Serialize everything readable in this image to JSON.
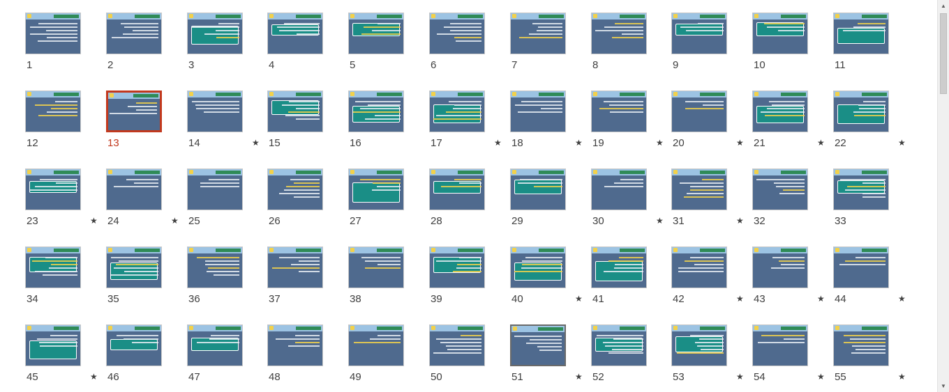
{
  "view": "slide-sorter",
  "selected_slide": "13",
  "current_slide": "51",
  "colors": {
    "slide_bg": "#4f6a8e",
    "title_band": "#9cc3e3",
    "title_bar": "#2f8b57",
    "accent_box": "#1a8e86",
    "selection": "#c2391e"
  },
  "scrollbar": {
    "up_icon": "▲",
    "down_icon": "▼"
  },
  "slides": [
    {
      "number": "1",
      "star": ""
    },
    {
      "number": "2",
      "star": ""
    },
    {
      "number": "3",
      "star": ""
    },
    {
      "number": "4",
      "star": ""
    },
    {
      "number": "5",
      "star": ""
    },
    {
      "number": "6",
      "star": ""
    },
    {
      "number": "7",
      "star": ""
    },
    {
      "number": "8",
      "star": ""
    },
    {
      "number": "9",
      "star": ""
    },
    {
      "number": "10",
      "star": ""
    },
    {
      "number": "11",
      "star": ""
    },
    {
      "number": "12",
      "star": ""
    },
    {
      "number": "13",
      "star": ""
    },
    {
      "number": "14",
      "star": "★"
    },
    {
      "number": "15",
      "star": ""
    },
    {
      "number": "16",
      "star": ""
    },
    {
      "number": "17",
      "star": "★"
    },
    {
      "number": "18",
      "star": "★"
    },
    {
      "number": "19",
      "star": "★"
    },
    {
      "number": "20",
      "star": "★"
    },
    {
      "number": "21",
      "star": "★"
    },
    {
      "number": "22",
      "star": "★"
    },
    {
      "number": "23",
      "star": "★"
    },
    {
      "number": "24",
      "star": "★"
    },
    {
      "number": "25",
      "star": ""
    },
    {
      "number": "26",
      "star": ""
    },
    {
      "number": "27",
      "star": ""
    },
    {
      "number": "28",
      "star": ""
    },
    {
      "number": "29",
      "star": ""
    },
    {
      "number": "30",
      "star": "★"
    },
    {
      "number": "31",
      "star": "★"
    },
    {
      "number": "32",
      "star": ""
    },
    {
      "number": "33",
      "star": ""
    },
    {
      "number": "34",
      "star": ""
    },
    {
      "number": "35",
      "star": ""
    },
    {
      "number": "36",
      "star": ""
    },
    {
      "number": "37",
      "star": ""
    },
    {
      "number": "38",
      "star": ""
    },
    {
      "number": "39",
      "star": ""
    },
    {
      "number": "40",
      "star": "★"
    },
    {
      "number": "41",
      "star": ""
    },
    {
      "number": "42",
      "star": "★"
    },
    {
      "number": "43",
      "star": "★"
    },
    {
      "number": "44",
      "star": "★"
    },
    {
      "number": "45",
      "star": "★"
    },
    {
      "number": "46",
      "star": ""
    },
    {
      "number": "47",
      "star": ""
    },
    {
      "number": "48",
      "star": ""
    },
    {
      "number": "49",
      "star": ""
    },
    {
      "number": "50",
      "star": ""
    },
    {
      "number": "51",
      "star": "★"
    },
    {
      "number": "52",
      "star": ""
    },
    {
      "number": "53",
      "star": "★"
    },
    {
      "number": "54",
      "star": "★"
    },
    {
      "number": "55",
      "star": "★"
    }
  ]
}
